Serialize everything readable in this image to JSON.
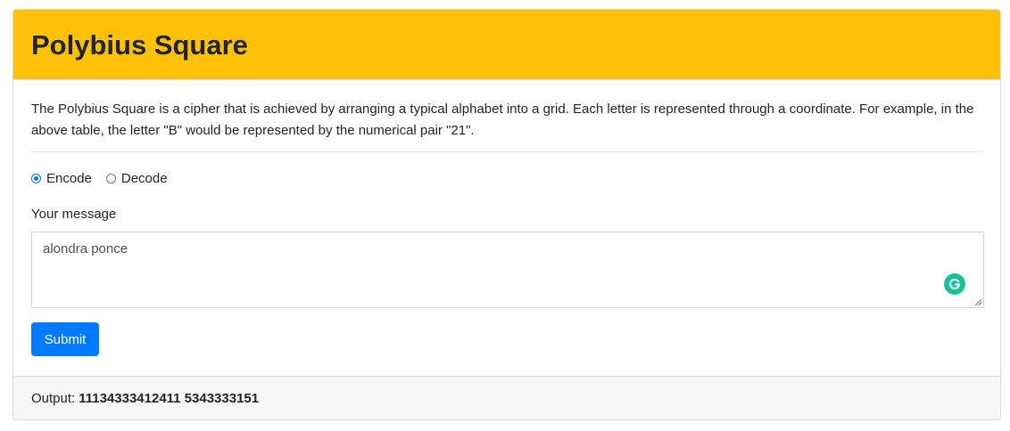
{
  "header": {
    "title": "Polybius Square"
  },
  "description": "The Polybius Square is a cipher that is achieved by arranging a typical alphabet into a grid. Each letter is represented through a coordinate. For example, in the above table, the letter \"B\" would be represented by the numerical pair \"21\".",
  "mode": {
    "options": [
      {
        "label": "Encode",
        "selected": true
      },
      {
        "label": "Decode",
        "selected": false
      }
    ]
  },
  "message": {
    "label": "Your message",
    "value": "alondra ponce"
  },
  "submit": {
    "label": "Submit"
  },
  "output": {
    "label": "Output:",
    "value": "11134333412411 5343333151"
  },
  "colors": {
    "header_bg": "#ffc107",
    "button_bg": "#007bff",
    "radio_accent": "#0075ff",
    "grammarly": "#15c39a"
  },
  "icons": {
    "grammarly": "grammarly-icon"
  }
}
